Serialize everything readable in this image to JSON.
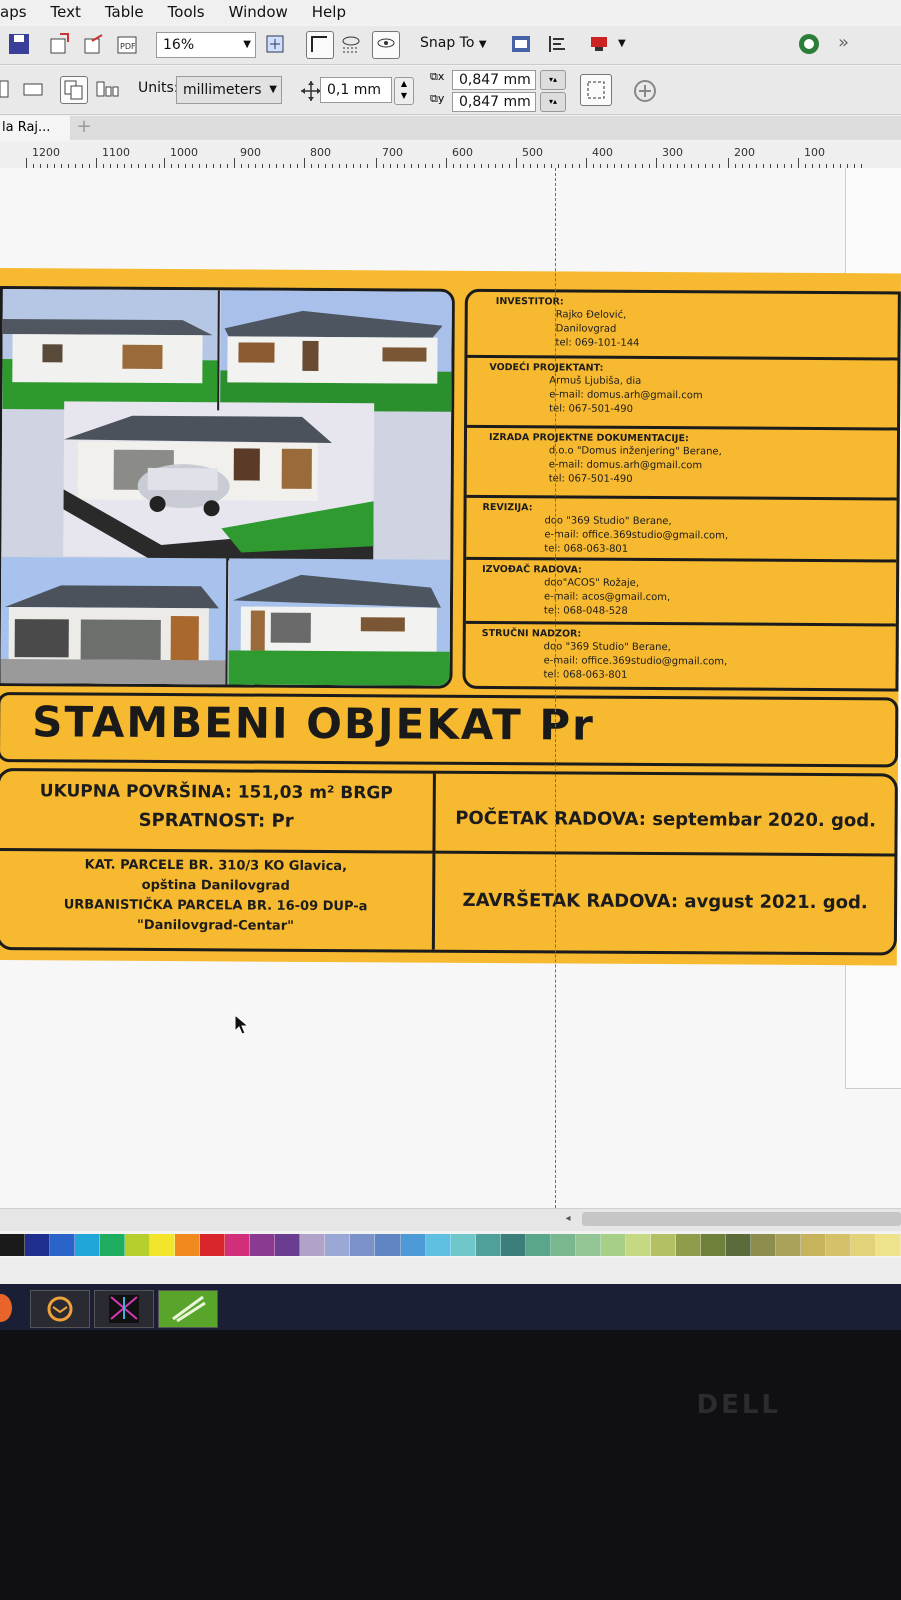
{
  "menu": {
    "items": [
      "aps",
      "Text",
      "Table",
      "Tools",
      "Window",
      "Help"
    ]
  },
  "toolbar1": {
    "zoom": "16%",
    "snap_label": "Snap To"
  },
  "toolbar2": {
    "units_label": "Units:",
    "units_value": "millimeters",
    "nudge_value": "0,1 mm",
    "dup_x": "0,847 mm",
    "dup_y": "0,847 mm"
  },
  "document_tab": {
    "label": "la Raj..."
  },
  "ruler": {
    "ticks": [
      "1200",
      "1100",
      "1000",
      "900",
      "800",
      "700",
      "600",
      "500",
      "400",
      "300",
      "200",
      "100"
    ]
  },
  "board": {
    "info": [
      {
        "heading": "INVESTITOR:",
        "lines": [
          "Rajko Đelović,",
          "Danilovgrad",
          "tel: 069-101-144"
        ]
      },
      {
        "heading": "VODEĆI PROJEKTANT:",
        "lines": [
          "Armuš Ljubiša, dia",
          "e-mail: domus.arh@gmail.com",
          "tel: 067-501-490"
        ]
      },
      {
        "heading": "IZRADA PROJEKTNE DOKUMENTACIJE:",
        "lines": [
          "d.o.o \"Domus inženjering\" Berane,",
          "e-mail: domus.arh@gmail.com",
          "tel: 067-501-490"
        ]
      },
      {
        "heading": "REVIZIJA:",
        "lines": [
          "doo \"369 Studio\" Berane,",
          "e-mail: office.369studio@gmail.com,",
          "tel: 068-063-801"
        ]
      },
      {
        "heading": "IZVOĐAČ RADOVA:",
        "lines": [
          "doo\"ACOS\" Rožaje,",
          "e-mail: acos@gmail.com,",
          "tel: 068-048-528"
        ]
      },
      {
        "heading": "STRUČNI NADZOR:",
        "lines": [
          "doo \"369 Studio\" Berane,",
          "e-mail: office.369studio@gmail.com,",
          "tel: 068-063-801"
        ]
      }
    ],
    "title": "STAMBENI OBJEKAT Pr",
    "area_line": "UKUPNA POVRŠINA: 151,03 m² BRGP",
    "floors_line": "SPRATNOST: Pr",
    "start_line": "POČETAK RADOVA: septembar 2020. god.",
    "parcel_lines": [
      "KAT. PARCELE BR. 310/3 KO Glavica,",
      "opština Danilovgrad",
      "URBANISTIČKA PARCELA BR. 16-09 DUP-a",
      "\"Danilovgrad-Centar\""
    ],
    "end_line": "ZAVRŠETAK RADOVA: avgust 2021. god."
  },
  "palette": [
    "#1a1a1a",
    "#1f2f8f",
    "#2b64c9",
    "#21a6d9",
    "#1fae61",
    "#b7cf2c",
    "#f3e52c",
    "#f08a1f",
    "#d8262a",
    "#d22f7a",
    "#8b3a92",
    "#6a3d91",
    "#b1a2c9",
    "#9aa8d6",
    "#7a92c8",
    "#5f85c2",
    "#4c9bd6",
    "#5fc0e1",
    "#6fc7c9",
    "#4f9f9a",
    "#3c7f7a",
    "#5aa68a",
    "#79b78f",
    "#94c594",
    "#a8cf87",
    "#c5d982",
    "#b5c064",
    "#8f9d4a",
    "#6f7f3c",
    "#5c6b3a",
    "#8d8d4f",
    "#aaa15a",
    "#c6b35c",
    "#d4c16a",
    "#e2d27a",
    "#efe28c"
  ],
  "taskbar": {
    "apps": [
      "mail-app",
      "coreldraw-app",
      "designer-app"
    ]
  },
  "monitor": {
    "brand": "DELL"
  }
}
